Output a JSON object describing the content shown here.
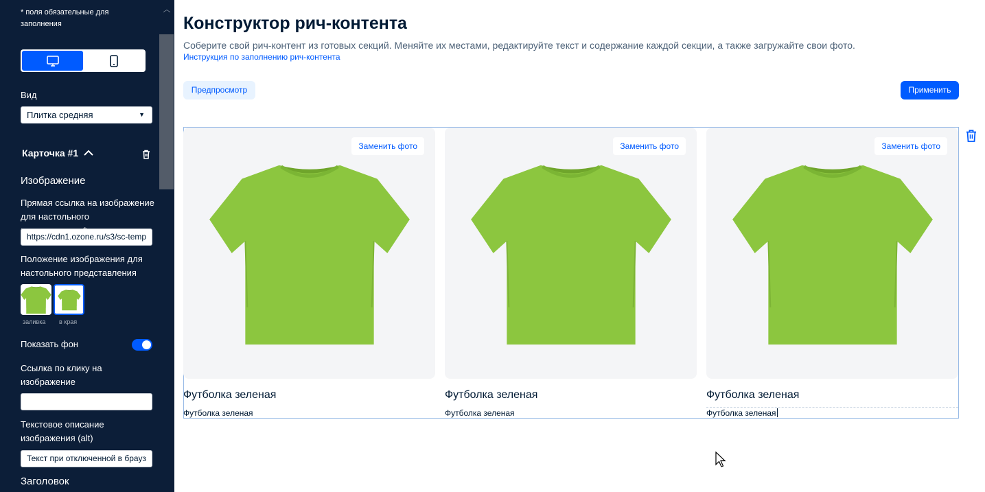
{
  "sidebar": {
    "required_note": "* поля обязательные для заполнения",
    "view_label": "Вид",
    "view_value": "Плитка средняя",
    "card_title": "Карточка #1",
    "image_section": "Изображение",
    "desktop_link_label": "Прямая ссылка на изображение для настольного представления*",
    "desktop_link_value": "https://cdn1.ozone.ru/s3/sc-temp",
    "position_label": "Положение изображения для настольного представления",
    "position_options": [
      "заливка",
      "в края"
    ],
    "show_bg_label": "Показать фон",
    "show_bg_on": true,
    "click_link_label": "Ссылка по клику на изображение",
    "click_link_value": "",
    "alt_label": "Текстовое описание изображения (alt)",
    "alt_value": "Текст при отключенной в брауз",
    "heading_section": "Заголовок"
  },
  "main": {
    "title": "Конструктор рич-контента",
    "description": "Соберите свой рич-контент из готовых секций. Меняйте их местами, редактируйте текст и содержание каждой секции, а также загружайте свои фото.",
    "instructions_link": "Инструкция по заполнению рич-контента",
    "preview_button": "Предпросмотр",
    "apply_button": "Применить",
    "tiles": [
      {
        "replace": "Заменить фото",
        "title": "Футболка зеленая",
        "desc": "Футболка зеленая"
      },
      {
        "replace": "Заменить фото",
        "title": "Футболка зеленая",
        "desc": "Футболка зеленая"
      },
      {
        "replace": "Заменить фото",
        "title": "Футболка зеленая",
        "desc": "Футболка зеленая"
      }
    ]
  },
  "colors": {
    "sidebar_bg": "#0c1e38",
    "accent": "#005bff",
    "shirt": "#8cc63f"
  }
}
